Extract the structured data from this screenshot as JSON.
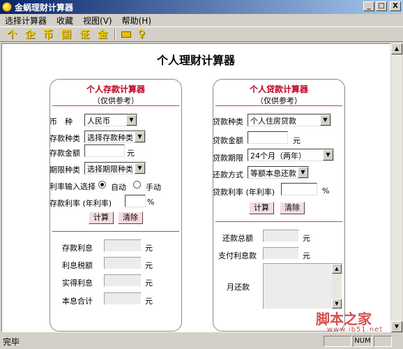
{
  "window": {
    "title": "金蜗理财计算器",
    "minimize_glyph": "_",
    "maximize_glyph": "□",
    "close_glyph": "X"
  },
  "menu": [
    "选择计算器",
    "收藏",
    "视图(V)",
    "帮助(H)"
  ],
  "toolbar": {
    "buttons": [
      "个",
      "企",
      "币",
      "国",
      "证",
      "金"
    ],
    "icons": [
      "printer-icon",
      "key-icon"
    ],
    "key_glyph": "♀"
  },
  "page": {
    "title": "个人理财计算器"
  },
  "deposit": {
    "title": "个人存款计算器",
    "subtitle": "（仅供参考）",
    "currency_label": "币　种",
    "currency_value": "人民币",
    "type_label": "存款种类",
    "type_value": "选择存款种类",
    "amount_label": "存款金额",
    "amount_unit": "元",
    "term_label": "期限种类",
    "term_value": "选择期限种类",
    "rate_mode_label": "利率输入选择",
    "rate_mode_auto": "自动",
    "rate_mode_manual": "手动",
    "rate_label": "存款利率 (年利率)",
    "rate_unit": "%",
    "calc_button": "计算",
    "clear_button": "清除",
    "interest_label": "存款利息",
    "tax_label": "利息税额",
    "net_label": "实得利息",
    "total_label": "本息合计",
    "out_unit": "元"
  },
  "loan": {
    "title": "个人贷款计算器",
    "subtitle": "（仅供参考）",
    "type_label": "贷款种类",
    "type_value": "个人住房贷款",
    "amount_label": "贷款金额",
    "amount_unit": "元",
    "term_label": "贷款期限",
    "term_value": "24个月（两年）",
    "method_label": "还款方式",
    "method_value": "等额本息还款",
    "rate_label": "贷款利率 (年利率)",
    "rate_unit": "%",
    "calc_button": "计算",
    "clear_button": "清除",
    "total_label": "还款总额",
    "interest_label": "支付利息款",
    "monthly_label": "月还款",
    "out_unit": "元"
  },
  "status": {
    "text": "完毕",
    "num": "NUM"
  },
  "watermark": {
    "text": "脚本之家",
    "url": "www.jb51.net"
  },
  "scroll_glyphs": {
    "up": "▲",
    "down": "▼"
  }
}
